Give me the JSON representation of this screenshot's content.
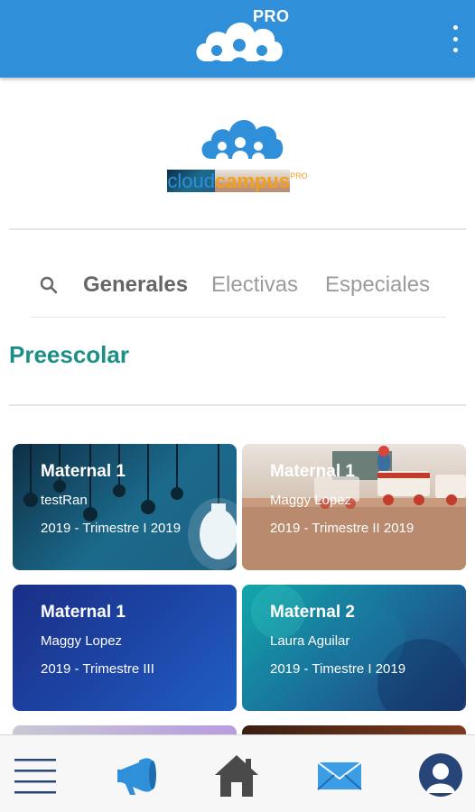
{
  "appbar": {
    "pro_label": "PRO",
    "icons": [
      "cloud-logo-icon",
      "more-vert-icon"
    ]
  },
  "brand": {
    "word_part1": "cloud",
    "word_part2": "campus",
    "pro_small": "PRO"
  },
  "tabs": {
    "search_icon": "search-icon",
    "items": [
      {
        "label": "Generales"
      },
      {
        "label": "Electivas"
      },
      {
        "label": "Especiales"
      }
    ]
  },
  "section": {
    "title": "Preescolar"
  },
  "cards": [
    {
      "title": "Maternal 1",
      "subtitle": "testRan",
      "period": "2019 - Trimestre I 2019",
      "theme": "lightbulbs"
    },
    {
      "title": "Maternal 1",
      "subtitle": "Maggy Lopez",
      "period": "2019 - Trimestre II 2019",
      "theme": "toy-train"
    },
    {
      "title": "Maternal 1",
      "subtitle": "Maggy Lopez",
      "period": "2019 - Trimestre III",
      "theme": "blue-gradient"
    },
    {
      "title": "Maternal 2",
      "subtitle": "Laura Aguilar",
      "period": "2019 - Timestre I 2019",
      "theme": "teal-grunge"
    }
  ],
  "bottom_nav": {
    "icons": [
      "hamburger-menu-icon",
      "megaphone-icon",
      "home-icon",
      "mail-icon",
      "profile-avatar-icon"
    ]
  },
  "colors": {
    "appbar": "#2f8fd8",
    "section_title": "#1c8f86",
    "brand_blue": "#2f8fd8",
    "brand_orange": "#f2a01c"
  }
}
